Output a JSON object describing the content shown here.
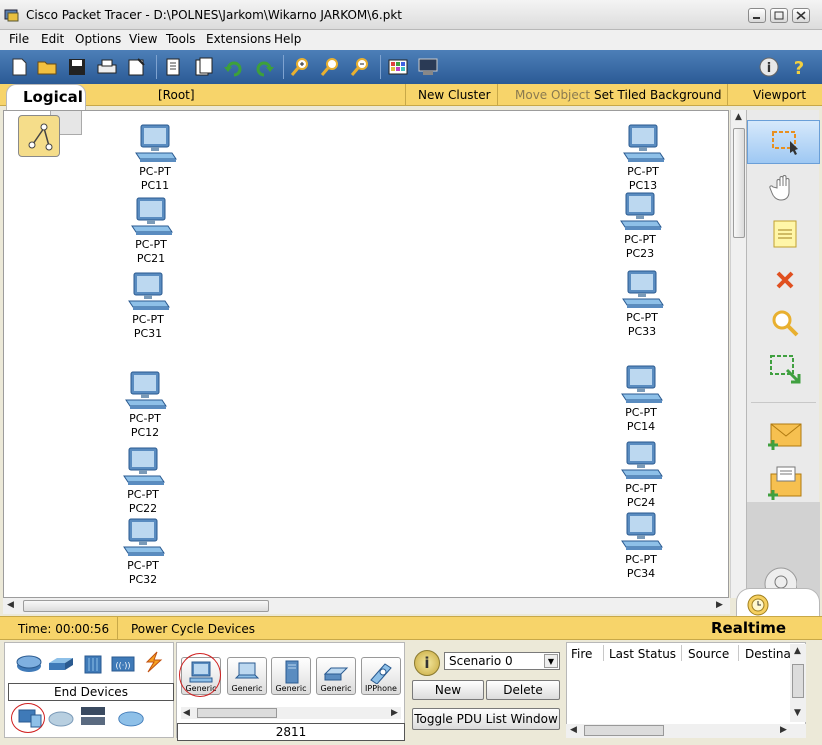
{
  "window": {
    "title": "Cisco Packet Tracer - D:\\POLNES\\Jarkom\\Wikarno JARKOM\\6.pkt"
  },
  "menu": [
    "File",
    "Edit",
    "Options",
    "View",
    "Tools",
    "Extensions",
    "Help"
  ],
  "toolbar": {
    "icons": [
      "new-file-icon",
      "open-folder-icon",
      "save-icon",
      "print-icon",
      "activity-wizard-icon",
      "copy-icon",
      "paste-icon",
      "undo-icon",
      "redo-icon",
      "zoom-in-icon",
      "zoom-reset-icon",
      "zoom-out-icon",
      "palette-icon",
      "custom-device-icon",
      "info-icon",
      "help-icon"
    ]
  },
  "logical_bar": {
    "tab": "Logical",
    "root": "[Root]",
    "new_cluster": "New Cluster",
    "move_object": "Move Object",
    "set_background": "Set Tiled Background",
    "viewport": "Viewport"
  },
  "devices": [
    {
      "type": "PC-PT",
      "name": "PC11"
    },
    {
      "type": "PC-PT",
      "name": "PC21"
    },
    {
      "type": "PC-PT",
      "name": "PC31"
    },
    {
      "type": "PC-PT",
      "name": "PC12"
    },
    {
      "type": "PC-PT",
      "name": "PC22"
    },
    {
      "type": "PC-PT",
      "name": "PC32"
    },
    {
      "type": "PC-PT",
      "name": "PC13"
    },
    {
      "type": "PC-PT",
      "name": "PC23"
    },
    {
      "type": "PC-PT",
      "name": "PC33"
    },
    {
      "type": "PC-PT",
      "name": "PC14"
    },
    {
      "type": "PC-PT",
      "name": "PC24"
    },
    {
      "type": "PC-PT",
      "name": "PC34"
    }
  ],
  "right_tools": [
    "select-icon",
    "hand-icon",
    "note-icon",
    "delete-icon",
    "inspect-icon",
    "resize-icon",
    "add-simple-pdu-icon",
    "add-complex-pdu-icon"
  ],
  "status": {
    "time": "Time: 00:00:56",
    "power_cycle": "Power Cycle Devices",
    "mode": "Realtime"
  },
  "device_panel": {
    "category_label": "End Devices",
    "devices": [
      "Generic",
      "Generic",
      "Generic",
      "Generic",
      "IPPhone"
    ],
    "model_field": "2811"
  },
  "scenario": {
    "selected": "Scenario 0",
    "new_label": "New",
    "delete_label": "Delete",
    "toggle_label": "Toggle PDU List Window"
  },
  "pdu_table": {
    "columns": [
      "Fire",
      "Last Status",
      "Source",
      "Destinat"
    ]
  },
  "colors": {
    "toolbar_blue": "#2b5a95",
    "accent_yellow": "#f7d46a",
    "highlight_red": "#d02020"
  }
}
